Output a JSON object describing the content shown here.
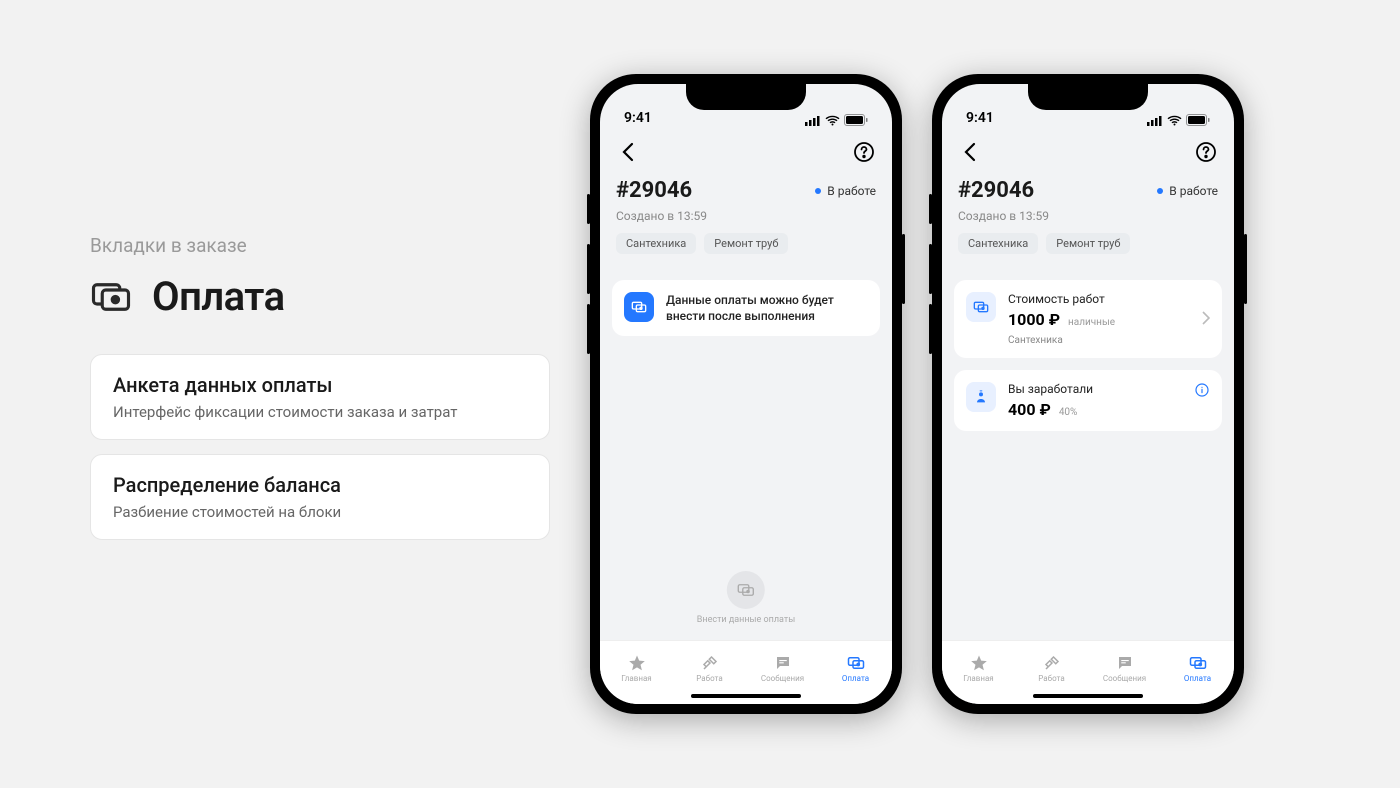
{
  "left": {
    "subtitle": "Вкладки в заказе",
    "title": "Оплата",
    "cards": [
      {
        "title": "Анкета данных оплаты",
        "desc": "Интерфейс фиксации стоимости заказа и затрат"
      },
      {
        "title": "Распределение баланса",
        "desc": "Разбиение стоимостей на блоки"
      }
    ]
  },
  "status_bar": {
    "time": "9:41"
  },
  "nav": {},
  "order": {
    "number": "#29046",
    "status": "В работе",
    "created": "Создано в 13:59",
    "tags": [
      "Сантехника",
      "Ремонт труб"
    ]
  },
  "phone1": {
    "info": "Данные оплаты можно будет внести после выполнения",
    "disabled_action": "Внести данные оплаты"
  },
  "phone2": {
    "cost": {
      "label": "Стоимость работ",
      "value": "1000 ₽",
      "method": "наличные",
      "category": "Сантехника"
    },
    "earned": {
      "label": "Вы заработали",
      "value": "400 ₽",
      "pct": "40%"
    }
  },
  "tabs": {
    "home": "Главная",
    "work": "Работа",
    "messages": "Сообщения",
    "payment": "Оплата"
  }
}
